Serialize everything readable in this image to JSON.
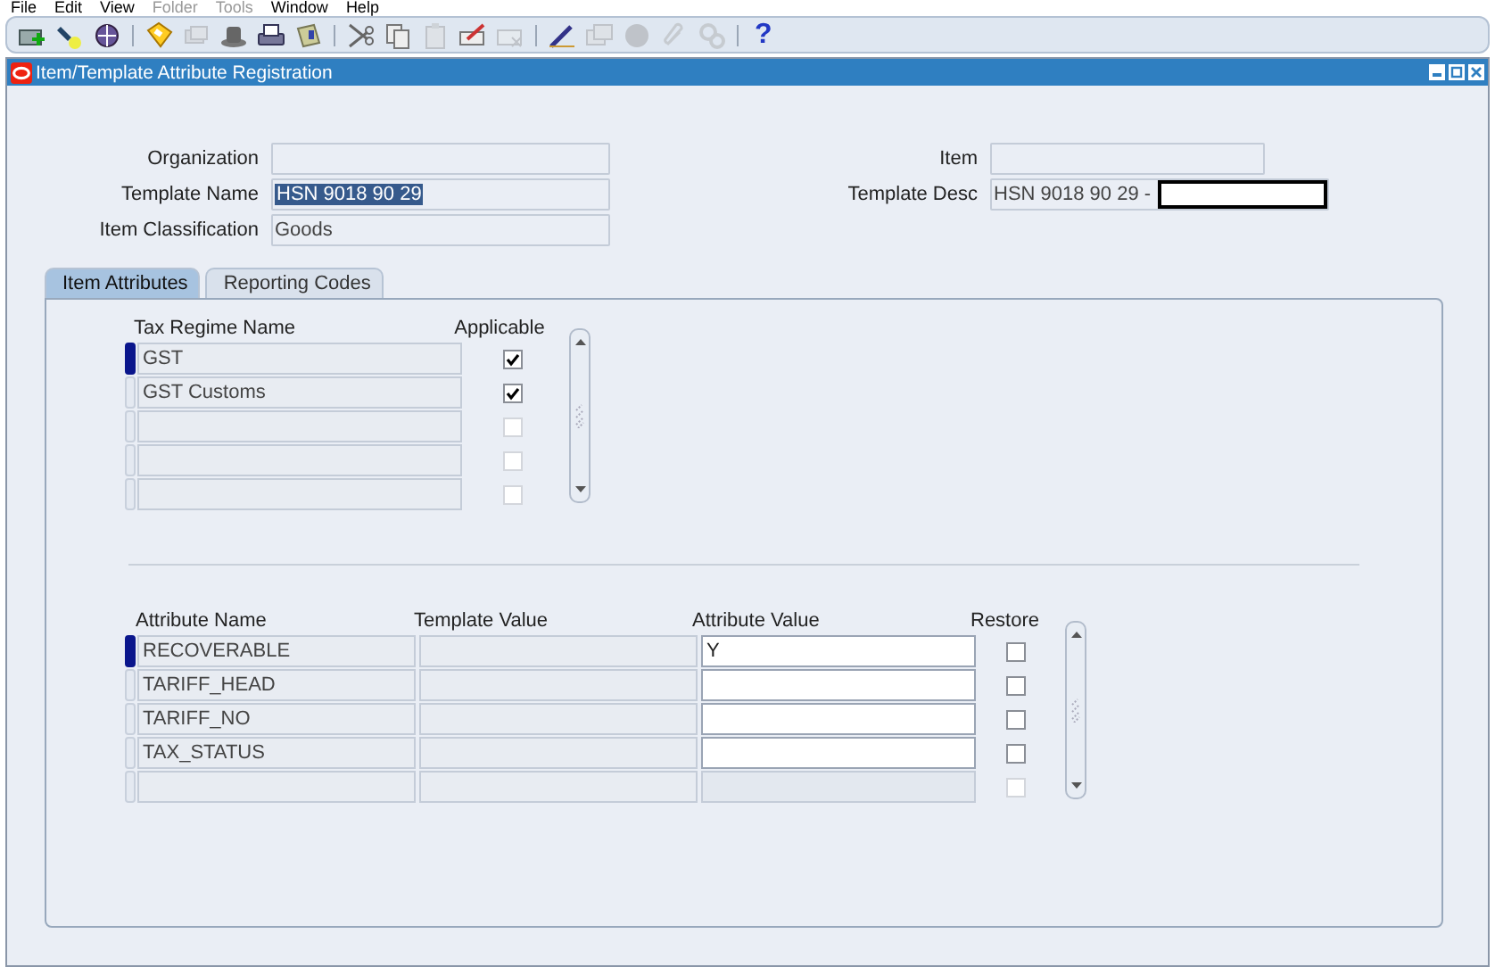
{
  "menu": [
    {
      "label": "File",
      "disabled": false
    },
    {
      "label": "Edit",
      "disabled": false
    },
    {
      "label": "View",
      "disabled": false
    },
    {
      "label": "Folder",
      "disabled": true
    },
    {
      "label": "Tools",
      "disabled": true
    },
    {
      "label": "Window",
      "disabled": false
    },
    {
      "label": "Help",
      "disabled": false
    }
  ],
  "toolbar": [
    {
      "kind": "button",
      "disabled": false
    },
    {
      "kind": "button",
      "disabled": false
    },
    {
      "kind": "button",
      "disabled": false
    },
    {
      "kind": "separator"
    },
    {
      "kind": "button",
      "disabled": false
    },
    {
      "kind": "button",
      "disabled": true
    },
    {
      "kind": "button",
      "disabled": false
    },
    {
      "kind": "button",
      "disabled": false
    },
    {
      "kind": "button",
      "disabled": false
    },
    {
      "kind": "separator"
    },
    {
      "kind": "button",
      "disabled": false
    },
    {
      "kind": "button",
      "disabled": false
    },
    {
      "kind": "button",
      "disabled": true
    },
    {
      "kind": "button",
      "disabled": false
    },
    {
      "kind": "button",
      "disabled": true
    },
    {
      "kind": "separator"
    },
    {
      "kind": "button",
      "disabled": false
    },
    {
      "kind": "button",
      "disabled": true
    },
    {
      "kind": "button",
      "disabled": true
    },
    {
      "kind": "button",
      "disabled": true
    },
    {
      "kind": "button",
      "disabled": true
    },
    {
      "kind": "separator"
    },
    {
      "kind": "help",
      "label": "?",
      "disabled": false
    }
  ],
  "window": {
    "title": "Item/Template Attribute Registration"
  },
  "header": {
    "left": [
      {
        "label": "Organization"
      },
      {
        "label": "Template Name",
        "value": "HSN 9018 90 29",
        "selected": true
      },
      {
        "label": "Item Classification",
        "value": "Goods"
      }
    ],
    "right": [
      {
        "label": "Item"
      },
      {
        "label": "Template Desc",
        "value": "HSN 9018 90 29 -",
        "redacted": true
      }
    ]
  },
  "tabs": [
    {
      "label": "Item Attributes",
      "selected": true
    },
    {
      "label": "Reporting Codes",
      "selected": false
    }
  ],
  "tax_regimes": {
    "columns": [
      "Tax Regime Name",
      "Applicable"
    ],
    "rows": [
      {
        "name": "GST",
        "applicable": true,
        "current": true,
        "disabled": false
      },
      {
        "name": "GST Customs",
        "applicable": true,
        "current": false,
        "disabled": false
      },
      {
        "applicable": false,
        "current": false,
        "disabled": true
      },
      {
        "applicable": false,
        "current": false,
        "disabled": true
      },
      {
        "applicable": false,
        "current": false,
        "disabled": true
      }
    ]
  },
  "attributes": {
    "columns": [
      "Attribute Name",
      "Template Value",
      "Attribute Value",
      "Restore"
    ],
    "rows": [
      {
        "name": "RECOVERABLE",
        "value": "Y",
        "restore": false,
        "current": true,
        "disabled": false
      },
      {
        "name": "TARIFF_HEAD",
        "restore": false,
        "current": false,
        "disabled": false
      },
      {
        "name": "TARIFF_NO",
        "restore": false,
        "current": false,
        "disabled": false
      },
      {
        "name": "TAX_STATUS",
        "restore": false,
        "current": false,
        "disabled": false
      },
      {
        "restore": false,
        "current": false,
        "disabled": true
      }
    ]
  }
}
